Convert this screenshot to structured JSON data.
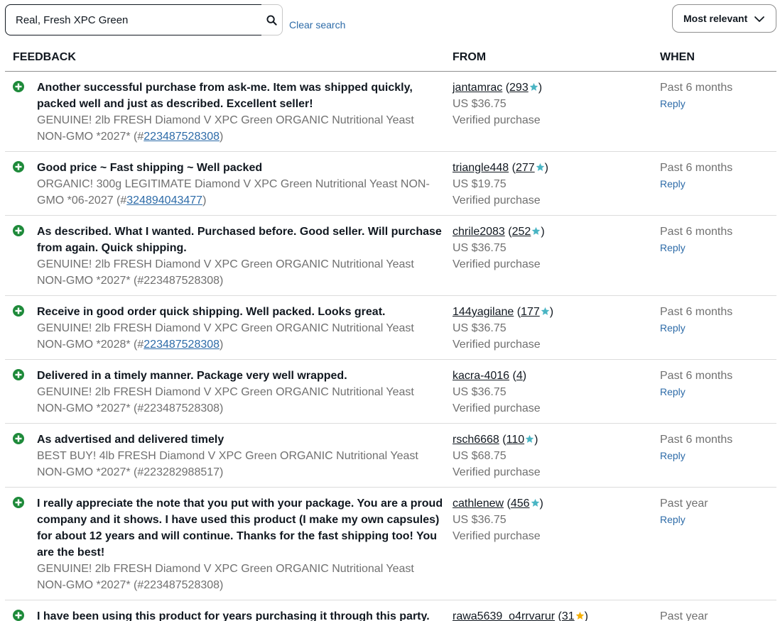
{
  "search": {
    "value": "Real, Fresh XPC Green",
    "clear_label": "Clear search"
  },
  "sort": {
    "label": "Most relevant"
  },
  "headers": {
    "feedback": "FEEDBACK",
    "from": "FROM",
    "when": "WHEN"
  },
  "colors": {
    "positive": "#1e8a3a",
    "link": "#2d6ba8",
    "star_teal": "#4ab5c4",
    "star_yellow": "#f5af02",
    "muted": "#707070"
  },
  "rows": [
    {
      "comment": "Another successful purchase from ask-me. Item was shipped quickly, packed well and just as described. Excellent seller!",
      "item_title": "GENUINE! 2lb FRESH Diamond V XPC Green ORGANIC Nutritional Yeast NON-GMO *2027* (#",
      "item_number": "223487528308",
      "item_number_linked": true,
      "user": "jantamrac",
      "score": "293",
      "star": "teal",
      "price": "US $36.75",
      "verified": "Verified purchase",
      "when": "Past 6 months",
      "reply": "Reply"
    },
    {
      "comment": "Good price ~ Fast shipping ~ Well packed",
      "item_title": "ORGANIC! 300g LEGITIMATE Diamond V XPC Green Nutritional Yeast NON-GMO *06-2027 (#",
      "item_number": "324894043477",
      "item_number_linked": true,
      "user": "triangle448",
      "score": "277",
      "star": "teal",
      "price": "US $19.75",
      "verified": "Verified purchase",
      "when": "Past 6 months",
      "reply": "Reply"
    },
    {
      "comment": "As described. What I wanted. Purchased before. Good seller. Will purchase from again. Quick shipping.",
      "item_title": "GENUINE! 2lb FRESH Diamond V XPC Green ORGANIC Nutritional Yeast NON-GMO *2027* (#",
      "item_number": "223487528308",
      "item_number_linked": false,
      "user": "chrile2083",
      "score": "252",
      "star": "teal",
      "price": "US $36.75",
      "verified": "Verified purchase",
      "when": "Past 6 months",
      "reply": "Reply"
    },
    {
      "comment": "Receive in good order quick shipping. Well packed. Looks great.",
      "item_title": "GENUINE! 2lb FRESH Diamond V XPC Green ORGANIC Nutritional Yeast NON-GMO *2028* (#",
      "item_number": "223487528308",
      "item_number_linked": true,
      "user": "144yagilane",
      "score": "177",
      "star": "teal",
      "price": "US $36.75",
      "verified": "Verified purchase",
      "when": "Past 6 months",
      "reply": "Reply"
    },
    {
      "comment": "Delivered in a timely manner. Package very well wrapped.",
      "item_title": "GENUINE! 2lb FRESH Diamond V XPC Green ORGANIC Nutritional Yeast NON-GMO *2027* (#",
      "item_number": "223487528308",
      "item_number_linked": false,
      "user": "kacra-4016",
      "score": "4",
      "star": "none",
      "price": "US $36.75",
      "verified": "Verified purchase",
      "when": "Past 6 months",
      "reply": "Reply"
    },
    {
      "comment": "As advertised and delivered timely",
      "item_title": "BEST BUY! 4lb FRESH Diamond V XPC Green ORGANIC Nutritional Yeast NON-GMO *2027* (#",
      "item_number": "223282988517",
      "item_number_linked": false,
      "user": "rsch6668",
      "score": "110",
      "star": "teal",
      "price": "US $68.75",
      "verified": "Verified purchase",
      "when": "Past 6 months",
      "reply": "Reply"
    },
    {
      "comment": "I really appreciate the note that you put with your package. You are a proud company and it shows. I have used this product (I make my own capsules) for about 12 years and will continue. Thanks for the fast shipping too! You are the best!",
      "item_title": "GENUINE! 2lb FRESH Diamond V XPC Green ORGANIC Nutritional Yeast NON-GMO *2027* (#",
      "item_number": "223487528308",
      "item_number_linked": false,
      "user": "cathlenew",
      "score": "456",
      "star": "teal",
      "price": "US $36.75",
      "verified": "Verified purchase",
      "when": "Past year",
      "reply": "Reply"
    },
    {
      "comment": "I have been using this product for years purchasing it through this party.",
      "item_title": "",
      "item_number": "",
      "item_number_linked": false,
      "user": "rawa5639_o4rrvarur",
      "score": "31",
      "star": "yellow",
      "price": "",
      "verified": "",
      "when": "Past year",
      "reply": ""
    }
  ]
}
